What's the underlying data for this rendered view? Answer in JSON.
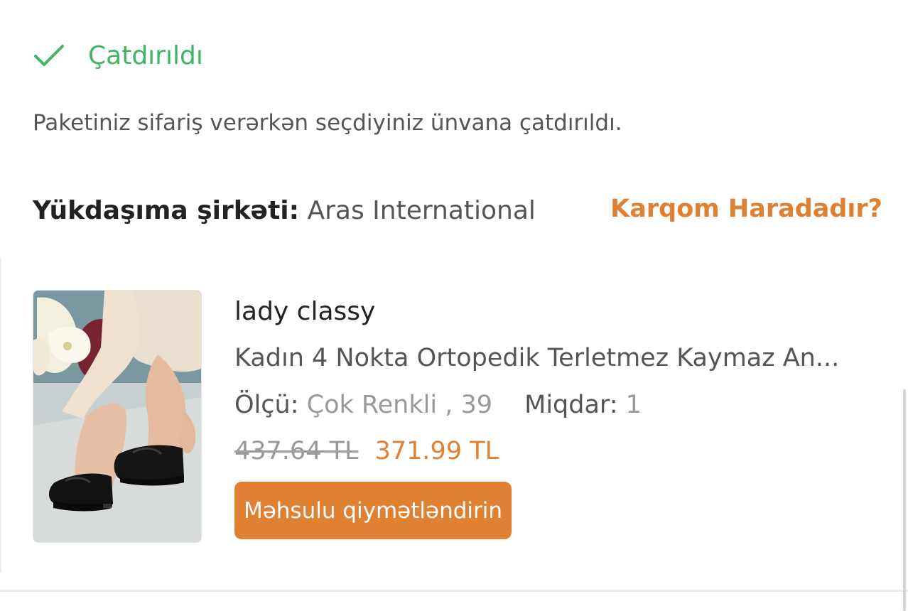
{
  "status": {
    "icon": "checkmark-icon",
    "title": "Çatdırıldı",
    "description": "Paketiniz sifariş verərkən seçdiyiniz ünvana çatdırıldı.",
    "color": "#3fb467"
  },
  "carrier": {
    "label": "Yükdaşıma şirkəti:",
    "value": "Aras International",
    "track_link": "Karqom Haradadır?"
  },
  "product": {
    "image_alt": "product-photo",
    "brand": "lady classy",
    "name": "Kadın 4 Nokta Ortopedik Terletmez Kaymaz An...",
    "size_label": "Ölçü:",
    "size_value": "Çok Renkli , 39",
    "quantity_label": "Miqdar:",
    "quantity_value": "1",
    "old_price": "437.64 TL",
    "new_price": "371.99 TL",
    "rate_button": "Məhsulu qiymətləndirin"
  },
  "colors": {
    "accent": "#e08033",
    "success": "#3fb467"
  }
}
